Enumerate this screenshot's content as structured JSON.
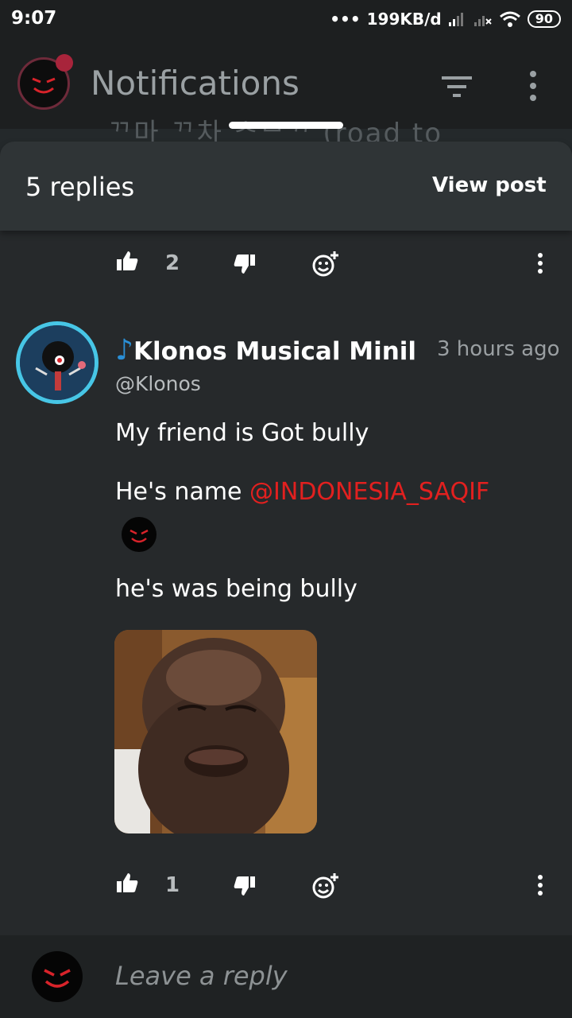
{
  "status_bar": {
    "time": "9:07",
    "dots": "•••",
    "net_speed": "199KB/d",
    "battery": "90"
  },
  "app_bar": {
    "title": "Notifications",
    "behind_text": "ᄁ마 ᄁ차 ᄎᄆᄁ (road to"
  },
  "sheet": {
    "reply_count": "5 replies",
    "view_post": "View post"
  },
  "previous_comment": {
    "like_count": "2"
  },
  "comment": {
    "author": "Klonos Musical Minil",
    "music_icon": "♪",
    "time": "3 hours ago",
    "handle": "@Klonos",
    "line1": "My friend is Got bully",
    "line2_prefix": "He's name ",
    "mention": "@INDONESIA_SAQIF",
    "line3": "he's was being bully",
    "like_count": "1"
  },
  "reply_bar": {
    "placeholder": "Leave a reply"
  },
  "colors": {
    "background": "#24292b",
    "header": "#2f3436",
    "mention": "#e2201f",
    "avatar_ring": "#47c6e6",
    "music_note": "#2a8fd6"
  }
}
